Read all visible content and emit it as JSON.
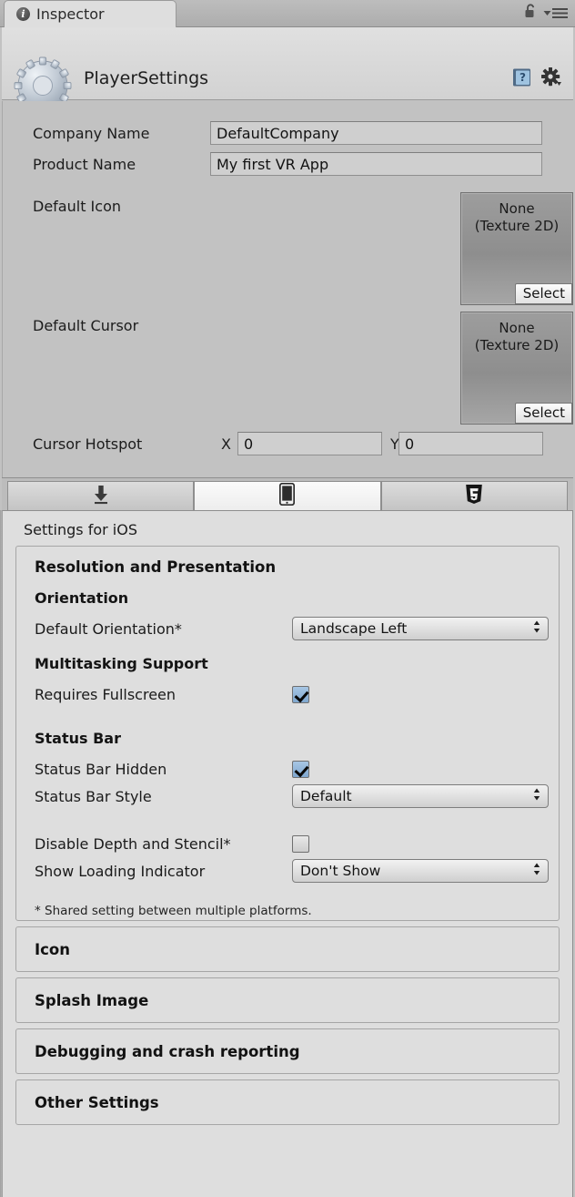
{
  "window": {
    "tab_label": "Inspector",
    "tab_icon": "info-circle-icon",
    "lock_icon": "lock-open-icon",
    "menu_icon": "hamburger-menu-icon"
  },
  "asset_header": {
    "title": "PlayerSettings",
    "asset_icon": "gear-asset-icon",
    "help_icon": "help-book-icon",
    "settings_icon": "gear-dropdown-icon"
  },
  "general": {
    "company_name_label": "Company Name",
    "company_name_value": "DefaultCompany",
    "product_name_label": "Product Name",
    "product_name_value": "My first VR App",
    "default_icon_label": "Default Icon",
    "default_cursor_label": "Default Cursor",
    "texture_none": "None",
    "texture_type": "(Texture 2D)",
    "select_label": "Select",
    "cursor_hotspot_label": "Cursor Hotspot",
    "hotspot_x_label": "X",
    "hotspot_x_value": "0",
    "hotspot_y_label": "Y",
    "hotspot_y_value": "0"
  },
  "platform_tabs": [
    {
      "name": "standalone",
      "icon": "download-arrow-icon",
      "active": false
    },
    {
      "name": "ios",
      "icon": "mobile-phone-icon",
      "active": true
    },
    {
      "name": "webgl",
      "icon": "html5-shield-icon",
      "active": false
    }
  ],
  "settings": {
    "title": "Settings for iOS",
    "group_title": "Resolution and Presentation",
    "orientation_heading": "Orientation",
    "default_orientation_label": "Default Orientation*",
    "default_orientation_value": "Landscape Left",
    "multitasking_heading": "Multitasking Support",
    "requires_fullscreen_label": "Requires Fullscreen",
    "requires_fullscreen_checked": true,
    "status_bar_heading": "Status Bar",
    "status_bar_hidden_label": "Status Bar Hidden",
    "status_bar_hidden_checked": true,
    "status_bar_style_label": "Status Bar Style",
    "status_bar_style_value": "Default",
    "disable_depth_label": "Disable Depth and Stencil*",
    "disable_depth_checked": false,
    "loading_indicator_label": "Show Loading Indicator",
    "loading_indicator_value": "Don't Show",
    "footnote": "* Shared setting between multiple platforms."
  },
  "collapsed_sections": [
    {
      "label": "Icon"
    },
    {
      "label": "Splash Image"
    },
    {
      "label": "Debugging and crash reporting"
    },
    {
      "label": "Other Settings"
    }
  ],
  "colors": {
    "panel_bg": "#dedede",
    "body_bg": "#c2c2c2",
    "checkbox_on": "#7fa7cf",
    "border": "#a6a6a6"
  }
}
